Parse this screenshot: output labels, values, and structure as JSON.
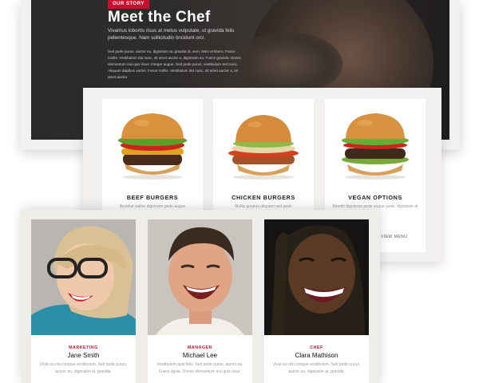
{
  "chef": {
    "badge": "OUR STORY",
    "title": "Meet the Chef",
    "lead": "Vivamus lobortis risus at metus vulputate, ut gravida felis pellentesque. Nam sollicitudin tincidunt orci.",
    "body": "Sed pede purus, auctor eu, dignissim at, gravida id, sem. Nam at libero. Fusce mollis. Vestibulum dui nunc, sit amet auctor a, dignissim eu. Fusce gravida. Donec elementum nisi quis risus. Integer augue. Sed pede purus, vestibulum sed nunc. Aliquam dapibus varius. Fusce mollis. Vestibulum dui nunc, sit amet auctor a, sit amet auctor."
  },
  "menu": {
    "items": [
      {
        "title": "BEEF BURGERS",
        "desc": "Bestibul walter dignissim pede augue"
      },
      {
        "title": "CHICKEN BURGERS",
        "desc": "Mollis gravida aliquam sed pede"
      },
      {
        "title": "VEGAN OPTIONS",
        "desc": "Blandit dignissim pede augue pede, dignissim at sem",
        "link": "VIEW MENU"
      }
    ]
  },
  "team": {
    "members": [
      {
        "role": "MARKETING",
        "name": "Jane Smith",
        "bio": "Vivat eu nisi congue vestibulum. Sed pede purus, auctor eu, dignissim at, gravida."
      },
      {
        "role": "MANAGER",
        "name": "Michael Lee",
        "bio": "Vestibulum quis felis. Sed pede purus, auctor eu. Fusce ligula. Donec elementum nisi quis risus."
      },
      {
        "role": "CHEF",
        "name": "Clara Mathison",
        "bio": "Vivat eu nisi congue vestibulum. Sed pede purus, auctor eu, dignissim at, gravida."
      }
    ]
  },
  "colors": {
    "accent": "#c8102e",
    "hero_bg": "#2b2a29",
    "card_bg": "#f2f1ef"
  }
}
